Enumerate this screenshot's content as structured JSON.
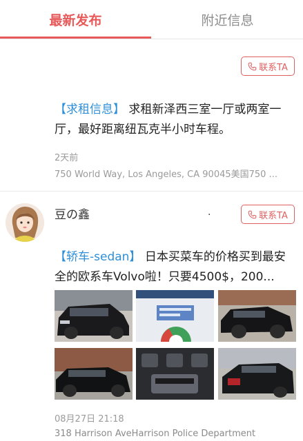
{
  "tabs": {
    "latest": "最新发布",
    "nearby": "附近信息"
  },
  "contact_label": "联系TA",
  "post1": {
    "tag": "【求租信息】",
    "text": " 求租新泽西三室一厅或两室一厅，最好距离纽瓦克半小时车程。",
    "time": "2天前",
    "location": "750 World Way, Los Angeles, CA 90045美国750 ..."
  },
  "post2": {
    "user": "豆の鑫",
    "dot": ".",
    "tag": "【轿车-sedan】",
    "text": " 日本买菜车的价格买到最安全的欧系车Volvo啦！只要4500$，200...",
    "time": "08月27日 21:18",
    "location": "318 Harrison AveHarrison Police Department",
    "photos": [
      {
        "label": "car-front-photo"
      },
      {
        "label": "price-estimate-screenshot"
      },
      {
        "label": "car-side-photo"
      },
      {
        "label": "car-rear-photo"
      },
      {
        "label": "dashboard-photo"
      },
      {
        "label": "car-rear-angle-photo"
      }
    ]
  },
  "colors": {
    "accent": "#e85a5a",
    "tag_blue": "#2f8fd8",
    "meta_gray": "#9a9a9a"
  }
}
